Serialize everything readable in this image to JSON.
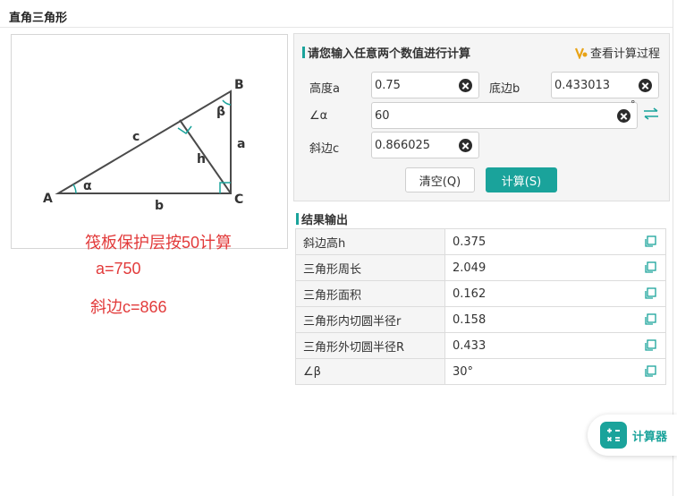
{
  "page": {
    "title": "直角三角形"
  },
  "diagram": {
    "vertex_a": "A",
    "vertex_b": "B",
    "vertex_c": "C",
    "side_a": "a",
    "side_b": "b",
    "side_c": "c",
    "height": "h",
    "angle_alpha": "α",
    "angle_beta": "β",
    "line_color": "#4a4a4a",
    "marker_color": "#1aa39b"
  },
  "notes": {
    "line1": "筏板保护层按50计算",
    "line2": "a=750",
    "line3": "斜边c=866",
    "color": "#e23b3b"
  },
  "input_panel": {
    "title": "请您输入任意两个数值进行计算",
    "vip_link": "查看计算过程",
    "fields": {
      "height_a": {
        "label": "高度a",
        "value": "0.75"
      },
      "base_b": {
        "label": "底边b",
        "value": "0.433013"
      },
      "angle_alpha": {
        "label": "∠α",
        "value": "60",
        "unit": "°"
      },
      "hypotenuse_c": {
        "label": "斜边c",
        "value": "0.866025"
      }
    },
    "clear_button": "清空(Q)",
    "calc_button": "计算(S)"
  },
  "results": {
    "title": "结果输出",
    "rows": [
      {
        "label": "斜边高h",
        "value": "0.375"
      },
      {
        "label": "三角形周长",
        "value": "2.049"
      },
      {
        "label": "三角形面积",
        "value": "0.162"
      },
      {
        "label": "三角形内切圆半径r",
        "value": "0.158"
      },
      {
        "label": "三角形外切圆半径R",
        "value": "0.433"
      },
      {
        "label": "∠β",
        "value": "30°"
      }
    ]
  },
  "calculator_widget": {
    "label": "计算器"
  },
  "colors": {
    "accent": "#1aa39b",
    "panel_bg": "#f5f5f5",
    "border": "#dcdcdc"
  }
}
